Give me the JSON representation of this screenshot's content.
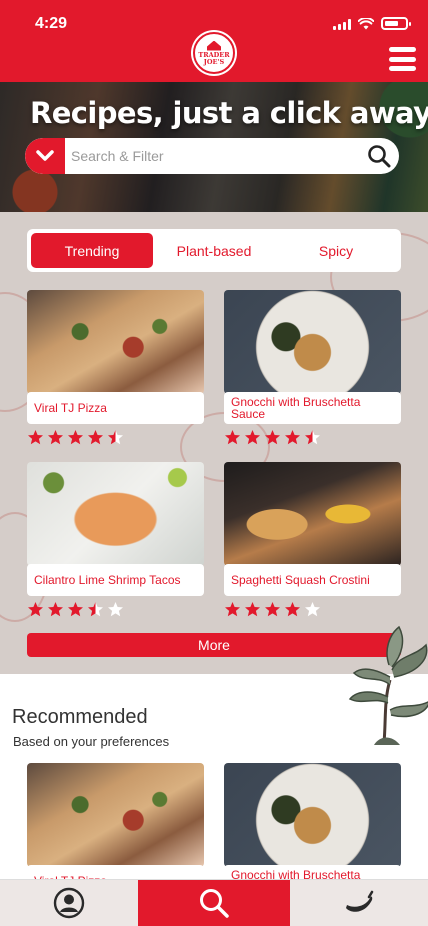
{
  "status": {
    "time": "4:29"
  },
  "brand": {
    "logo_text": "TRADER JOE'S"
  },
  "hero": {
    "title": "Recipes, just a click away!"
  },
  "search": {
    "placeholder": "Search & Filter"
  },
  "tabs": [
    {
      "label": "Trending",
      "active": true
    },
    {
      "label": "Plant-based",
      "active": false
    },
    {
      "label": "Spicy",
      "active": false
    }
  ],
  "trending": [
    {
      "title": "Viral TJ Pizza",
      "rating": 4.5
    },
    {
      "title": "Gnocchi with Bruschetta Sauce",
      "rating": 4.5
    },
    {
      "title": "Cilantro Lime Shrimp Tacos",
      "rating": 3.5
    },
    {
      "title": "Spaghetti Squash Crostini",
      "rating": 4
    }
  ],
  "more_label": "More",
  "recommended": {
    "title": "Recommended",
    "subtitle": "Based on your preferences"
  },
  "nav": {
    "active": "search"
  },
  "colors": {
    "brand_red": "#e2192c",
    "panel_bg": "#d5cdc9",
    "nav_bg": "#ede7e5"
  }
}
